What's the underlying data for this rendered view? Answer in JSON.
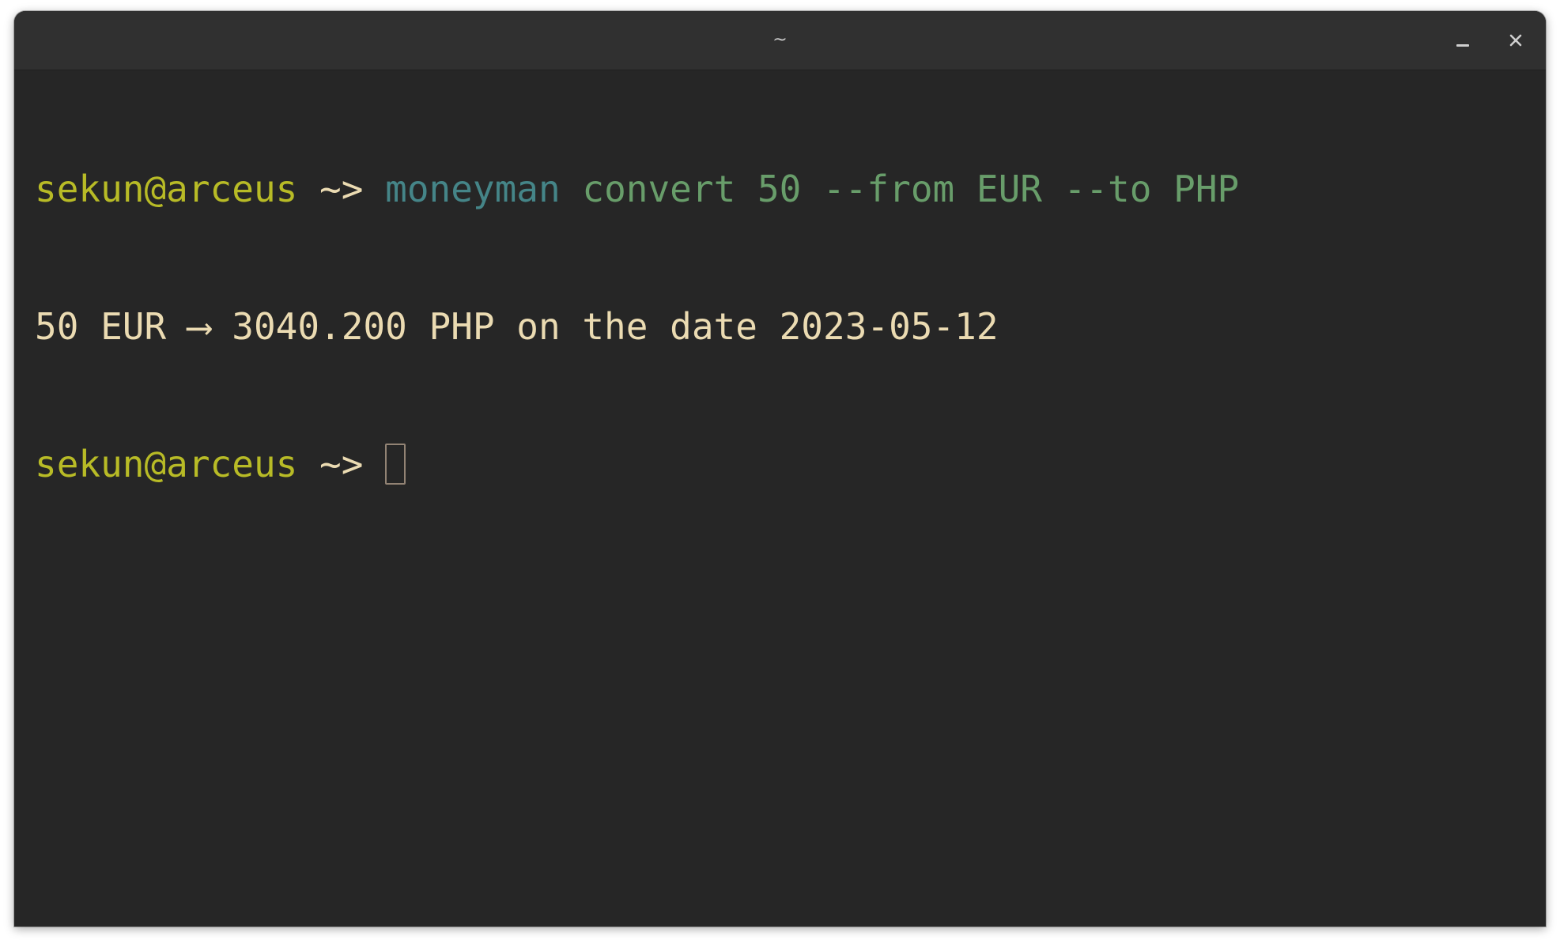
{
  "window": {
    "title": "~",
    "controls": {
      "minimize_icon": "minimize-icon",
      "close_icon": "close-icon"
    }
  },
  "terminal": {
    "lines": [
      {
        "user_host": "sekun@arceus",
        "prompt_symbol": " ~>",
        "command_bin": "moneyman",
        "command_args": " convert 50 --from EUR --to PHP"
      },
      {
        "output": "50 EUR ⟶ 3040.200 PHP on the date 2023-05-12"
      },
      {
        "user_host": "sekun@arceus",
        "prompt_symbol": " ~>"
      }
    ]
  },
  "colors": {
    "background": "#262626",
    "titlebar": "#303030",
    "user_host": "#b8bb26",
    "command_bin": "#458588",
    "command_args": "#689d6a",
    "output_text": "#ebdbb2",
    "cursor_outline": "#928374"
  }
}
